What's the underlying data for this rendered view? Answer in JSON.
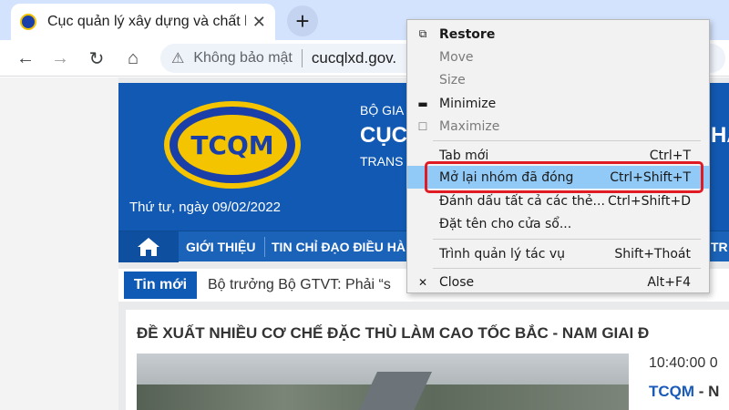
{
  "browser": {
    "tab_title": "Cục quản lý xây dựng và chất lượ",
    "tab_close": "✕",
    "new_tab": "+",
    "back": "←",
    "forward": "→",
    "reload": "↻",
    "home": "⌂",
    "security_label": "Không bảo mật",
    "url": "cucqlxd.gov."
  },
  "page": {
    "logo_text": "TCQM",
    "ministry_prefix": "BỘ GIA",
    "department_prefix": "CỤC",
    "translation_prefix": "TRANS",
    "banner_right": "HẤ",
    "date": "Thứ tư, ngày 09/02/2022",
    "nav": {
      "intro": "GIỚI THIỆU",
      "news_partial": "TIN CHỈ ĐẠO ĐIỀU HÀ",
      "right_partial": "TR"
    },
    "ticker_label": "Tin mới",
    "ticker_text": "Bộ trưởng Bộ GTVT: Phải “s",
    "article": {
      "title": "ĐỀ XUẤT NHIỀU CƠ CHẾ ĐẶC THÙ LÀM CAO TỐC BẮC - NAM GIAI Đ",
      "time": "10:40:00 0",
      "source": "TCQM",
      "source_suffix": "- N"
    }
  },
  "context_menu": {
    "items": [
      {
        "icon": "⧉",
        "label": "Restore",
        "shortcut": ""
      },
      {
        "icon": "",
        "label": "Move",
        "shortcut": ""
      },
      {
        "icon": "",
        "label": "Size",
        "shortcut": ""
      },
      {
        "icon": "▬",
        "label": "Minimize",
        "shortcut": ""
      },
      {
        "icon": "☐",
        "label": "Maximize",
        "shortcut": ""
      },
      {
        "icon": "",
        "label": "Tab mới",
        "shortcut": "Ctrl+T"
      },
      {
        "icon": "",
        "label": "Mở lại nhóm đã đóng",
        "shortcut": "Ctrl+Shift+T"
      },
      {
        "icon": "",
        "label": "Đánh dấu tất cả các thẻ...",
        "shortcut": "Ctrl+Shift+D"
      },
      {
        "icon": "",
        "label": "Đặt tên cho cửa sổ...",
        "shortcut": ""
      },
      {
        "icon": "",
        "label": "Trình quản lý tác vụ",
        "shortcut": "Shift+Thoát"
      },
      {
        "icon": "✕",
        "label": "Close",
        "shortcut": "Alt+F4"
      }
    ]
  },
  "colors": {
    "highlight": "#91c9f7",
    "annotation_outline": "#e01b24",
    "banner_blue": "#1259b3"
  }
}
